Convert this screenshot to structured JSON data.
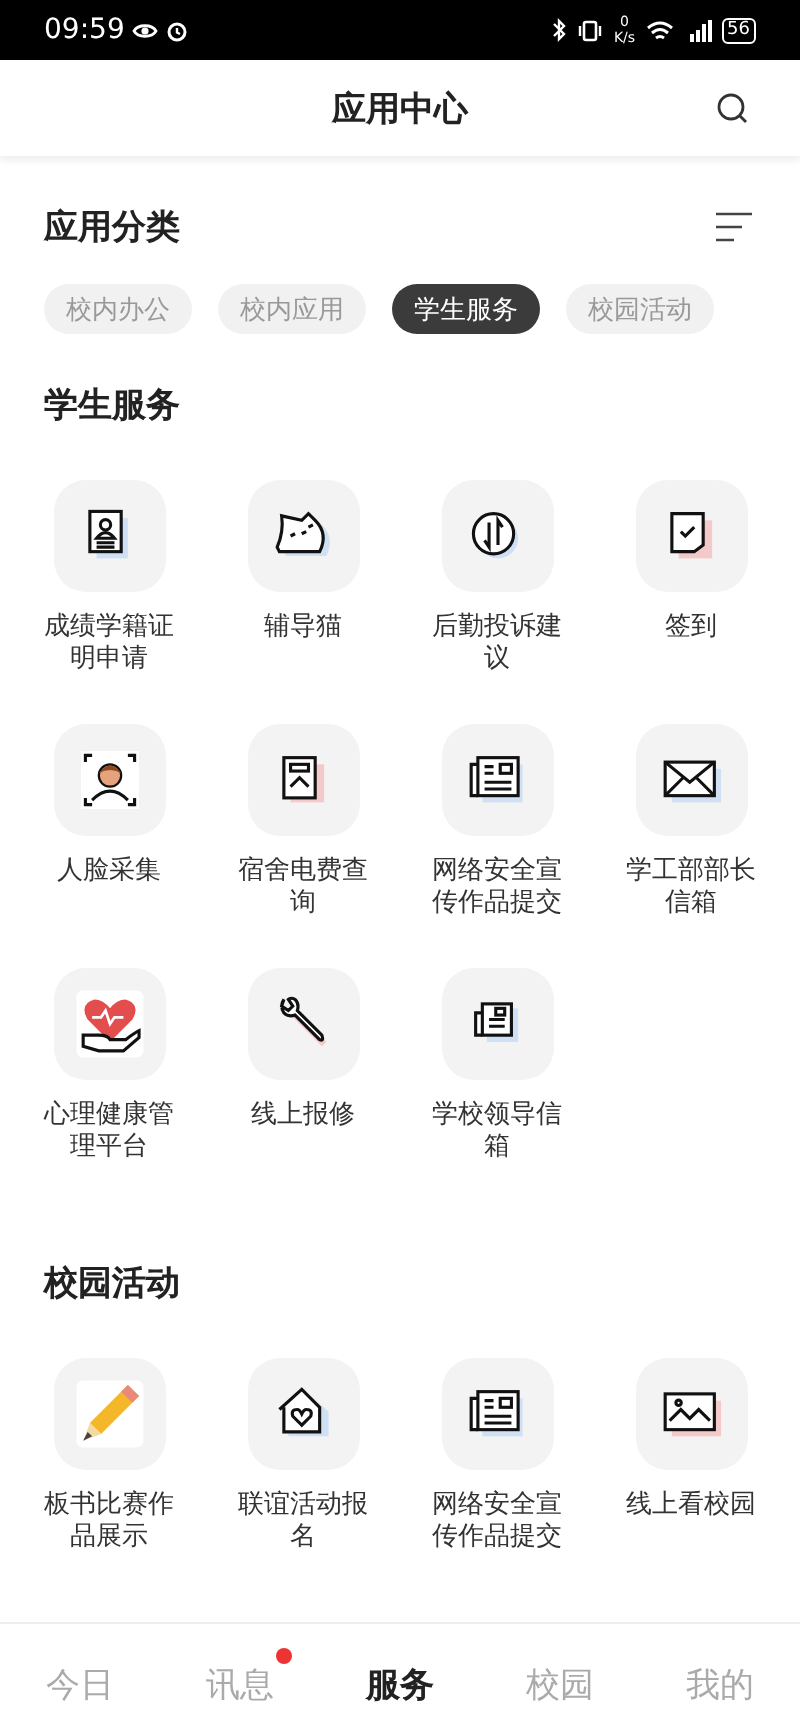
{
  "status_bar": {
    "time": "09:59",
    "speed_value": "0",
    "speed_unit": "K/s",
    "battery": "56"
  },
  "header": {
    "title": "应用中心"
  },
  "categories": {
    "title": "应用分类",
    "chips": [
      {
        "label": "校内办公",
        "selected": false
      },
      {
        "label": "校内应用",
        "selected": false
      },
      {
        "label": "学生服务",
        "selected": true
      },
      {
        "label": "校园活动",
        "selected": false
      }
    ]
  },
  "sections": [
    {
      "title": "学生服务",
      "apps": [
        {
          "label": "成绩学籍证明申请"
        },
        {
          "label": "辅导猫"
        },
        {
          "label": "后勤投诉建议"
        },
        {
          "label": "签到"
        },
        {
          "label": "人脸采集"
        },
        {
          "label": "宿舍电费查询"
        },
        {
          "label": "网络安全宣传作品提交"
        },
        {
          "label": "学工部部长信箱"
        },
        {
          "label": "心理健康管理平台"
        },
        {
          "label": "线上报修"
        },
        {
          "label": "学校领导信箱"
        }
      ]
    },
    {
      "title": "校园活动",
      "apps": [
        {
          "label": "板书比赛作品展示"
        },
        {
          "label": "联谊活动报名"
        },
        {
          "label": "网络安全宣传作品提交"
        },
        {
          "label": "线上看校园"
        }
      ]
    }
  ],
  "tab_bar": [
    {
      "label": "今日",
      "selected": false,
      "badge": false
    },
    {
      "label": "讯息",
      "selected": false,
      "badge": true
    },
    {
      "label": "服务",
      "selected": true,
      "badge": false
    },
    {
      "label": "校园",
      "selected": false,
      "badge": false
    },
    {
      "label": "我的",
      "selected": false,
      "badge": false
    }
  ]
}
